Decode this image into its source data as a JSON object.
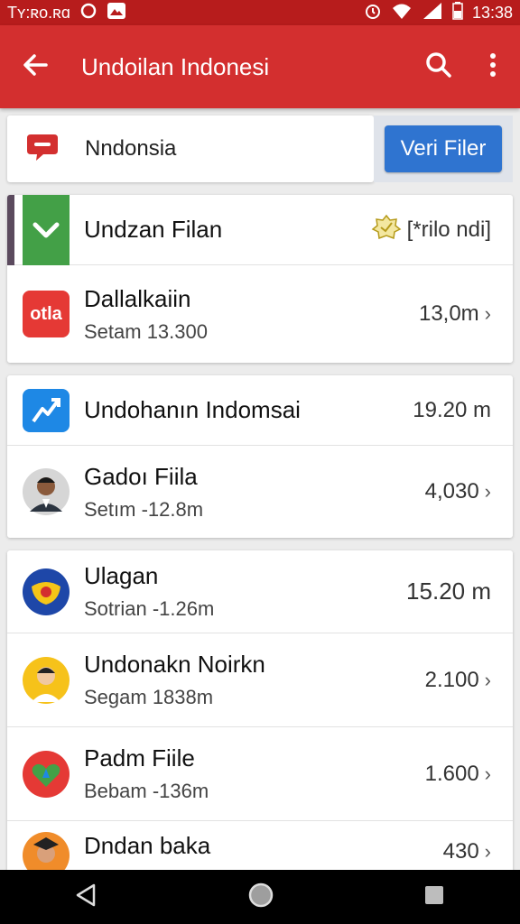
{
  "status_bar": {
    "left_text": "Tʏ:ʀᴏ.ʀɑ",
    "time": "13:38"
  },
  "app_bar": {
    "title": "Undoilan Indonesi"
  },
  "search": {
    "value": "Nndonsia",
    "filter_button": "Veri Filer"
  },
  "card1": {
    "rows": [
      {
        "name": "Undzan Filan",
        "value": "[*rilo ndi]"
      },
      {
        "name": "Dallalkaiin",
        "sub": "Setam 13.300",
        "value": "13,0m",
        "icon_text": "otla"
      }
    ]
  },
  "card2": {
    "rows": [
      {
        "name": "Undohanın Indomsai",
        "value": "19.20 m"
      },
      {
        "name": "Gadoı Fiila",
        "sub": "Setım -12.8m",
        "value": "4,030"
      }
    ]
  },
  "card3": {
    "rows": [
      {
        "name": "Ulagan",
        "sub": "Sotrian -1.26m",
        "value": "15.20 m"
      },
      {
        "name": "Undonakn Noirkn",
        "sub": "Segam 1838m",
        "value": "2.100"
      },
      {
        "name": "Padm Fiile",
        "sub": "Bebam -136m",
        "value": "1.600"
      },
      {
        "name": "Dndan baka",
        "value": "430"
      }
    ]
  },
  "colors": {
    "app_bar": "#d32f2f",
    "status_bar": "#b71c1c",
    "filter_button": "#2f74d0",
    "positive": "#2e9a2e",
    "negative": "#c62828"
  },
  "icons": [
    "back-arrow-icon",
    "search-icon",
    "more-vert-icon",
    "chat-bubble-icon",
    "check-icon",
    "badge-icon",
    "trend-chart-icon",
    "chevron-right-icon",
    "back-nav-icon",
    "home-nav-icon",
    "recents-nav-icon"
  ]
}
